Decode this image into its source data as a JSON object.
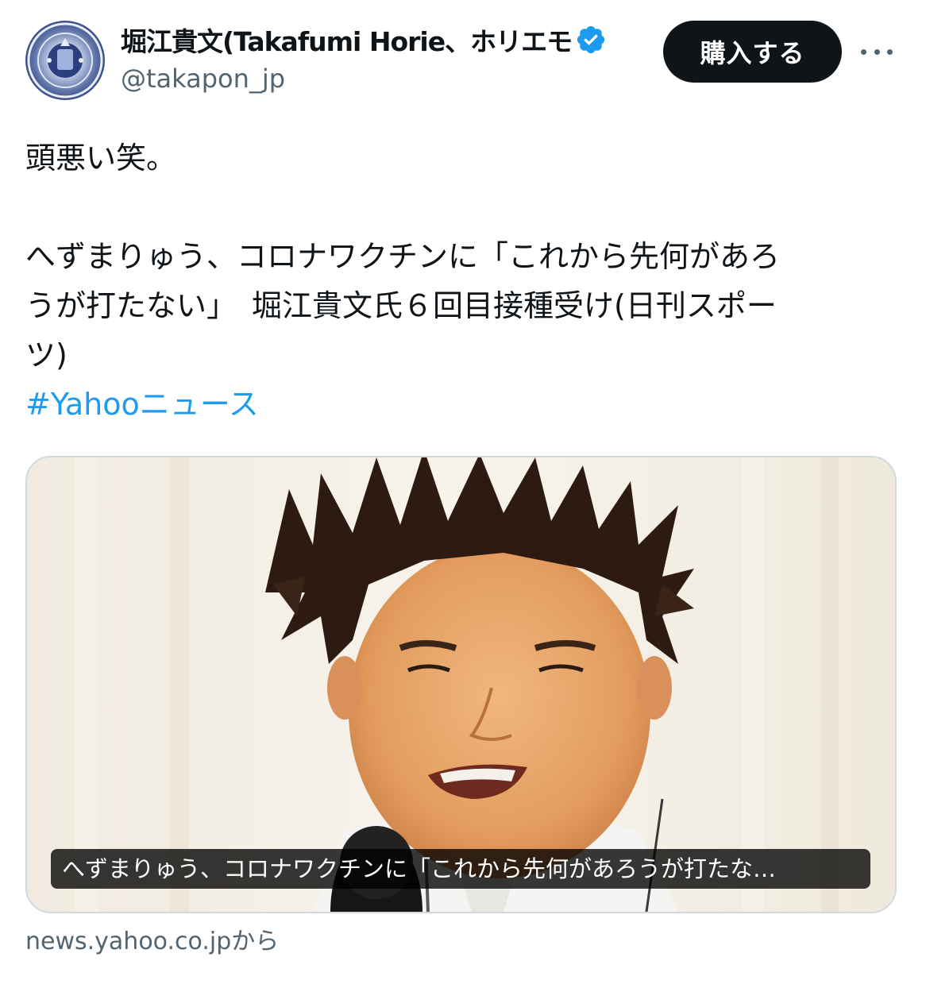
{
  "author": {
    "name": "堀江貴文(Takafumi Horie、ホリエモ",
    "handle": "@takapon_jp",
    "verified_color": "#1d9bf0"
  },
  "header": {
    "buy_label": "購入する",
    "more_icon": "more-horizontal-icon"
  },
  "tweet": {
    "line1": "頭悪い笑。",
    "line2": "へずまりゅう、コロナワクチンに「これから先何があろ",
    "line3": "うが打たない」　堀江貴文氏６回目接種受け(日刊スポー",
    "line4": "ツ)",
    "hashtag": "#Yahooニュース"
  },
  "card": {
    "caption": "へずまりゅう、コロナワクチンに「これから先何があろうが打たな…"
  },
  "source": {
    "label": "news.yahoo.co.jpから"
  },
  "colors": {
    "text": "#0f1419",
    "secondary": "#536471",
    "link": "#1d9bf0",
    "button_bg": "#0f1419"
  }
}
